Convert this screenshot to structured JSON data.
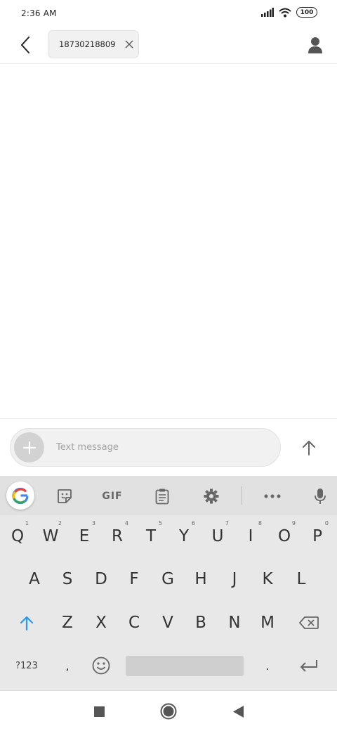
{
  "status_bar": {
    "time": "2:36 AM",
    "battery": "100",
    "icons": [
      "signal-icon",
      "wifi-icon",
      "battery-icon"
    ]
  },
  "header": {
    "recipient": "18730218809",
    "back_icon": "chevron-left-icon",
    "chip_close_icon": "close-icon",
    "contact_icon": "person-icon"
  },
  "composer": {
    "placeholder": "Text message",
    "add_icon": "plus-icon",
    "send_icon": "arrow-up-icon"
  },
  "keyboard": {
    "toolbar": {
      "gif_label": "GIF",
      "items": [
        "google-icon",
        "sticker-icon",
        "gif-button",
        "clipboard-icon",
        "gear-icon",
        "more-icon",
        "mic-icon"
      ]
    },
    "row1": [
      {
        "label": "Q",
        "hint": "1"
      },
      {
        "label": "W",
        "hint": "2"
      },
      {
        "label": "E",
        "hint": "3"
      },
      {
        "label": "R",
        "hint": "4"
      },
      {
        "label": "T",
        "hint": "5"
      },
      {
        "label": "Y",
        "hint": "6"
      },
      {
        "label": "U",
        "hint": "7"
      },
      {
        "label": "I",
        "hint": "8"
      },
      {
        "label": "O",
        "hint": "9"
      },
      {
        "label": "P",
        "hint": "0"
      }
    ],
    "row2": [
      "A",
      "S",
      "D",
      "F",
      "G",
      "H",
      "J",
      "K",
      "L"
    ],
    "row3": [
      "Z",
      "X",
      "C",
      "V",
      "B",
      "N",
      "M"
    ],
    "row4": {
      "symbols": "?123",
      "comma": ",",
      "period": "."
    },
    "accent_color": "#2a9af0"
  },
  "nav_bar": {
    "items": [
      "recents-square-icon",
      "home-circle-icon",
      "back-triangle-icon"
    ]
  }
}
